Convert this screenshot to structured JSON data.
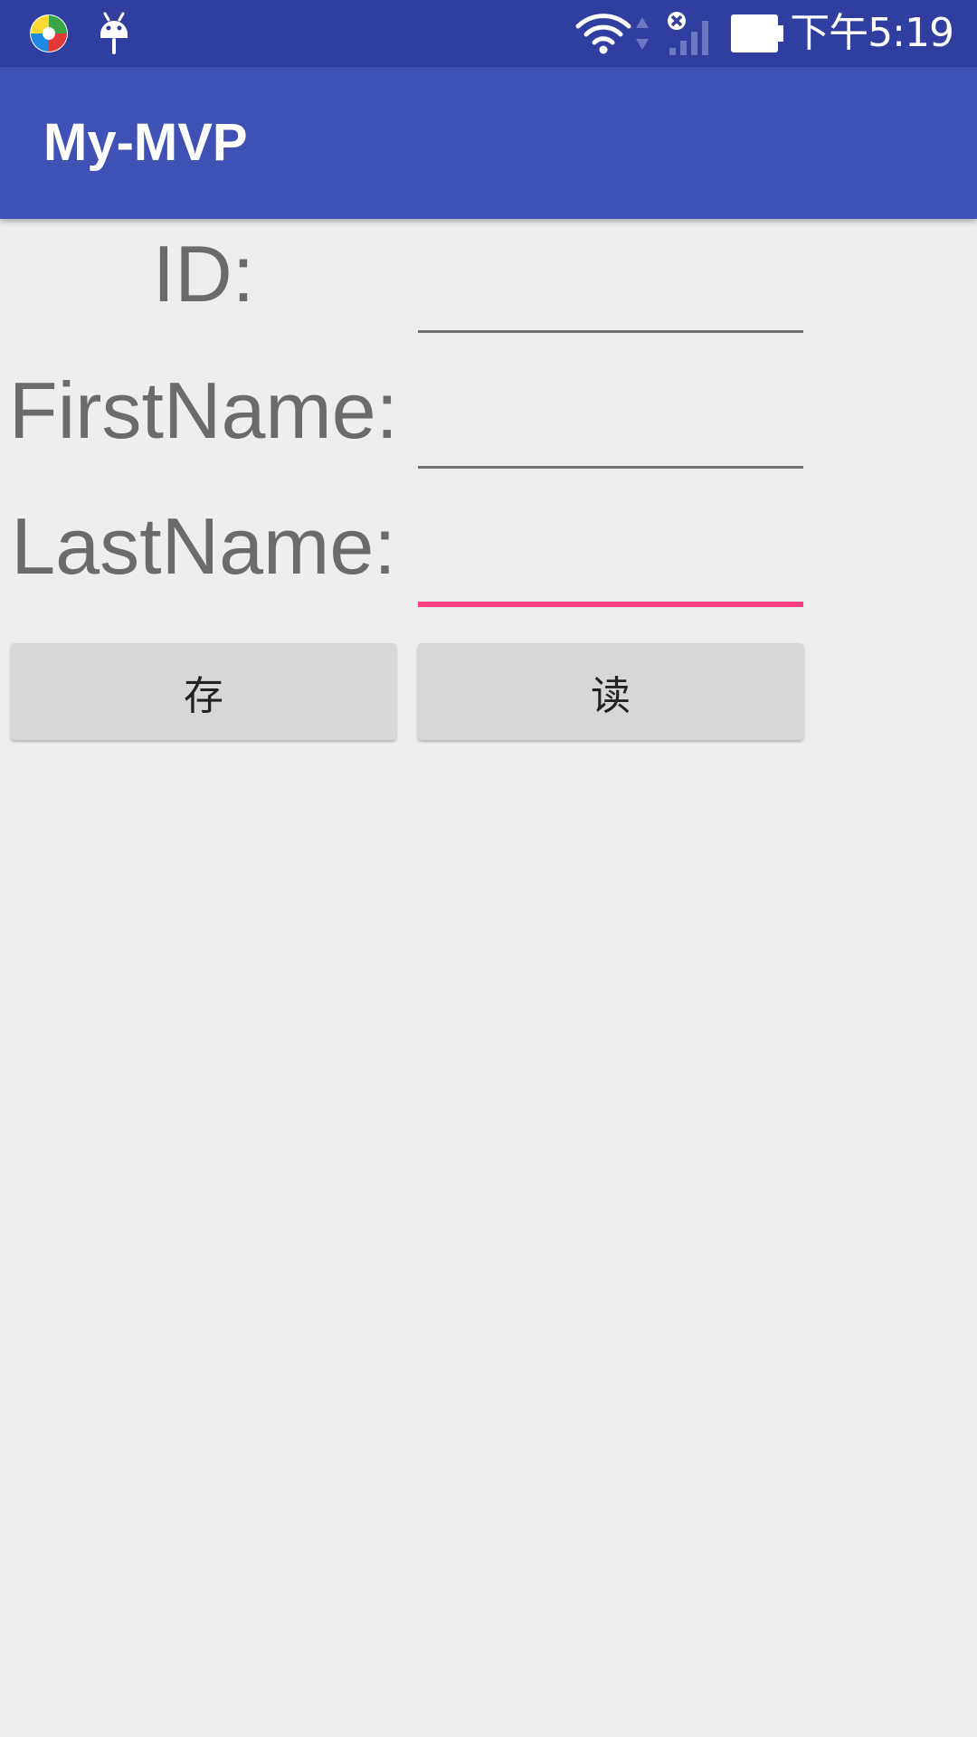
{
  "status_bar": {
    "time": "下午5:19",
    "icons": [
      "app-launcher-icon",
      "android-debug-icon",
      "wifi-icon",
      "data-activity-icon",
      "no-signal-icon",
      "battery-icon"
    ],
    "background_color": "#303f9f"
  },
  "app_bar": {
    "title": "My-MVP",
    "background_color": "#3f51b5"
  },
  "form": {
    "id_label": "ID:",
    "id_value": "",
    "firstname_label": "FirstName:",
    "firstname_value": "",
    "lastname_label": "LastName:",
    "lastname_value": "",
    "focused_field": "lastname",
    "accent_color": "#ff4081"
  },
  "buttons": {
    "save_label": "存",
    "read_label": "读"
  }
}
